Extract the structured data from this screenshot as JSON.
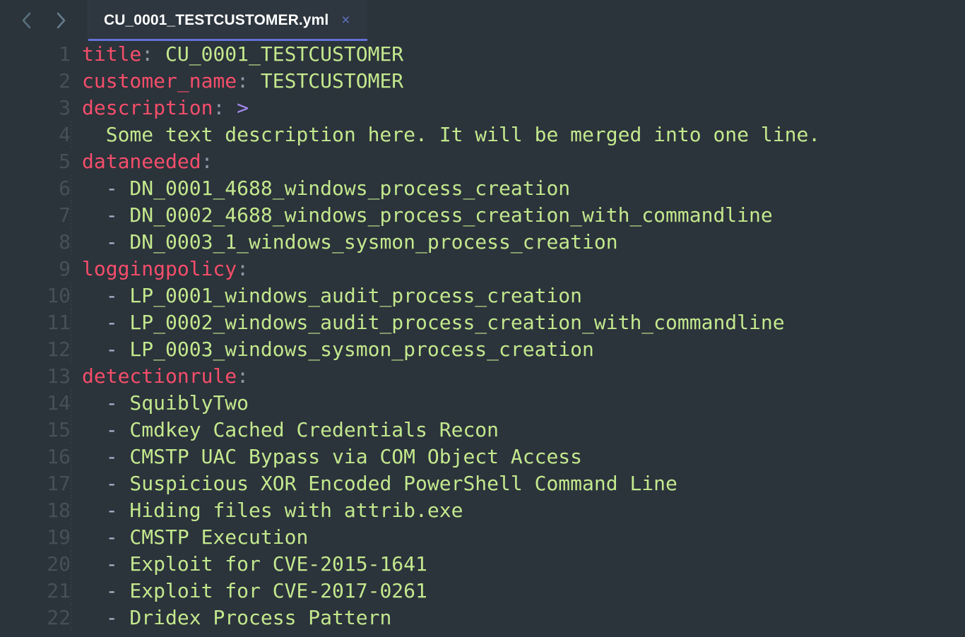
{
  "window": {
    "title": "CU_0001_TESTCUSTOMER.yml",
    "background": "#2b333b"
  },
  "tabbar": {
    "nav": {
      "back_icon": "chevron-left-icon",
      "forward_icon": "chevron-right-icon"
    },
    "tabs": [
      {
        "label": "CU_0001_TESTCUSTOMER.yml",
        "close_label": "×",
        "active": true,
        "underline_color": "#6272d6",
        "close_color": "#5d6fbd"
      }
    ]
  },
  "editor": {
    "language": "yaml",
    "filename": "CU_0001_TESTCUSTOMER.yml",
    "total_lines": 22,
    "colors": {
      "background": "#2b333b",
      "gutter_text": "#475059",
      "key": "#f54e6a",
      "colon": "#8b98a6",
      "value": "#c3e88d",
      "dash": "#aab6cd",
      "fold_marker": "#a78bf0",
      "indent_guide": "#3c454e"
    },
    "lines": [
      {
        "number": "1",
        "indented": false,
        "tokens": [
          {
            "cls": "t-key",
            "text": "title"
          },
          {
            "cls": "t-colon",
            "text": ":"
          },
          {
            "cls": "t-val",
            "text": " CU_0001_TESTCUSTOMER"
          }
        ]
      },
      {
        "number": "2",
        "indented": false,
        "tokens": [
          {
            "cls": "t-key",
            "text": "customer_name"
          },
          {
            "cls": "t-colon",
            "text": ":"
          },
          {
            "cls": "t-val",
            "text": " TESTCUSTOMER"
          }
        ]
      },
      {
        "number": "3",
        "indented": false,
        "tokens": [
          {
            "cls": "t-key",
            "text": "description"
          },
          {
            "cls": "t-colon",
            "text": ":"
          },
          {
            "cls": "t-fold",
            "text": " >"
          }
        ]
      },
      {
        "number": "4",
        "indented": true,
        "tokens": [
          {
            "cls": "t-plain",
            "text": "  Some text description here. It will be merged into one line."
          }
        ]
      },
      {
        "number": "5",
        "indented": false,
        "tokens": [
          {
            "cls": "t-key",
            "text": "dataneeded"
          },
          {
            "cls": "t-colon",
            "text": ":"
          }
        ]
      },
      {
        "number": "6",
        "indented": true,
        "tokens": [
          {
            "cls": "t-dash",
            "text": "  -"
          },
          {
            "cls": "t-val",
            "text": " DN_0001_4688_windows_process_creation"
          }
        ]
      },
      {
        "number": "7",
        "indented": true,
        "tokens": [
          {
            "cls": "t-dash",
            "text": "  -"
          },
          {
            "cls": "t-val",
            "text": " DN_0002_4688_windows_process_creation_with_commandline"
          }
        ]
      },
      {
        "number": "8",
        "indented": true,
        "tokens": [
          {
            "cls": "t-dash",
            "text": "  -"
          },
          {
            "cls": "t-val",
            "text": " DN_0003_1_windows_sysmon_process_creation"
          }
        ]
      },
      {
        "number": "9",
        "indented": false,
        "tokens": [
          {
            "cls": "t-key",
            "text": "loggingpolicy"
          },
          {
            "cls": "t-colon",
            "text": ":"
          }
        ]
      },
      {
        "number": "10",
        "indented": true,
        "tokens": [
          {
            "cls": "t-dash",
            "text": "  -"
          },
          {
            "cls": "t-val",
            "text": " LP_0001_windows_audit_process_creation"
          }
        ]
      },
      {
        "number": "11",
        "indented": true,
        "tokens": [
          {
            "cls": "t-dash",
            "text": "  -"
          },
          {
            "cls": "t-val",
            "text": " LP_0002_windows_audit_process_creation_with_commandline"
          }
        ]
      },
      {
        "number": "12",
        "indented": true,
        "tokens": [
          {
            "cls": "t-dash",
            "text": "  -"
          },
          {
            "cls": "t-val",
            "text": " LP_0003_windows_sysmon_process_creation"
          }
        ]
      },
      {
        "number": "13",
        "indented": false,
        "tokens": [
          {
            "cls": "t-key",
            "text": "detectionrule"
          },
          {
            "cls": "t-colon",
            "text": ":"
          }
        ]
      },
      {
        "number": "14",
        "indented": true,
        "tokens": [
          {
            "cls": "t-dash",
            "text": "  -"
          },
          {
            "cls": "t-val",
            "text": " SquiblyTwo"
          }
        ]
      },
      {
        "number": "15",
        "indented": true,
        "tokens": [
          {
            "cls": "t-dash",
            "text": "  -"
          },
          {
            "cls": "t-val",
            "text": " Cmdkey Cached Credentials Recon"
          }
        ]
      },
      {
        "number": "16",
        "indented": true,
        "tokens": [
          {
            "cls": "t-dash",
            "text": "  -"
          },
          {
            "cls": "t-val",
            "text": " CMSTP UAC Bypass via COM Object Access"
          }
        ]
      },
      {
        "number": "17",
        "indented": true,
        "tokens": [
          {
            "cls": "t-dash",
            "text": "  -"
          },
          {
            "cls": "t-val",
            "text": " Suspicious XOR Encoded PowerShell Command Line"
          }
        ]
      },
      {
        "number": "18",
        "indented": true,
        "tokens": [
          {
            "cls": "t-dash",
            "text": "  -"
          },
          {
            "cls": "t-val",
            "text": " Hiding files with attrib.exe"
          }
        ]
      },
      {
        "number": "19",
        "indented": true,
        "tokens": [
          {
            "cls": "t-dash",
            "text": "  -"
          },
          {
            "cls": "t-val",
            "text": " CMSTP Execution"
          }
        ]
      },
      {
        "number": "20",
        "indented": true,
        "tokens": [
          {
            "cls": "t-dash",
            "text": "  -"
          },
          {
            "cls": "t-val",
            "text": " Exploit for CVE-2015-1641"
          }
        ]
      },
      {
        "number": "21",
        "indented": true,
        "tokens": [
          {
            "cls": "t-dash",
            "text": "  -"
          },
          {
            "cls": "t-val",
            "text": " Exploit for CVE-2017-0261"
          }
        ]
      },
      {
        "number": "22",
        "indented": true,
        "tokens": [
          {
            "cls": "t-dash",
            "text": "  -"
          },
          {
            "cls": "t-val",
            "text": " Dridex Process Pattern"
          }
        ]
      }
    ]
  }
}
